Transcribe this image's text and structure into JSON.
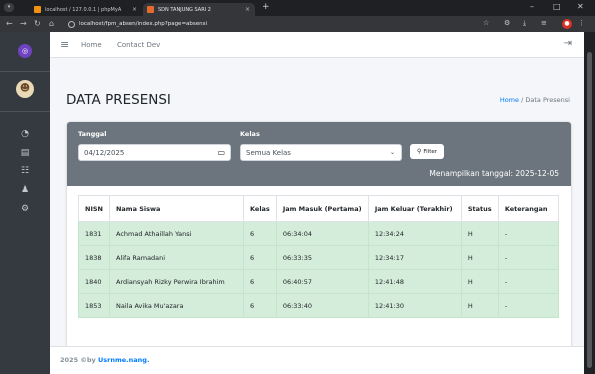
{
  "browser": {
    "tabs": [
      {
        "title": "localhost / 127.0.0.1 | phpMyA",
        "color": "#f29111"
      },
      {
        "title": "SDN TANJUNG SARI 2",
        "color": "#e66a2c"
      }
    ],
    "url": "localhost/fpm_absen/index.php?page=absensi",
    "new_tab": "+",
    "tab_close": "×",
    "minimize": "–",
    "maximize": "□",
    "close": "✕",
    "profile_initial": "●"
  },
  "topnav": {
    "home": "Home",
    "contact": "Contact Dev"
  },
  "page": {
    "title": "DATA PRESENSI",
    "breadcrumb_home": "Home",
    "breadcrumb_sep": "/",
    "breadcrumb_current": "Data Presensi"
  },
  "filter": {
    "tanggal_label": "Tanggal",
    "tanggal_value": "04/12/2025",
    "kelas_label": "Kelas",
    "kelas_value": "Semua Kelas",
    "button_label": "Filter",
    "showing_text": "Menampilkan tanggal: 2025-12-05"
  },
  "table": {
    "headers": [
      "NISN",
      "Nama Siswa",
      "Kelas",
      "Jam Masuk (Pertama)",
      "Jam Keluar (Terakhir)",
      "Status",
      "Keterangan"
    ],
    "rows": [
      [
        "1831",
        "Achmad Athaillah Yansi",
        "6",
        "06:34:04",
        "12:34:24",
        "H",
        "-"
      ],
      [
        "1838",
        "Alifa Ramadani",
        "6",
        "06:33:35",
        "12:34:17",
        "H",
        "-"
      ],
      [
        "1840",
        "Ardiansyah Rizky Perwira Ibrahim",
        "6",
        "06:40:57",
        "12:41:48",
        "H",
        "-"
      ],
      [
        "1853",
        "Naila Avika Mu'azara",
        "6",
        "06:33:40",
        "12:41:30",
        "H",
        "-"
      ]
    ]
  },
  "footer": {
    "prefix": "2025 ©by ",
    "brand": "Usrnme.nang."
  },
  "colors": {
    "sidebar": "#343a40",
    "filter_bg": "#6c757d",
    "row_success": "#d4edda",
    "link": "#007bff"
  }
}
